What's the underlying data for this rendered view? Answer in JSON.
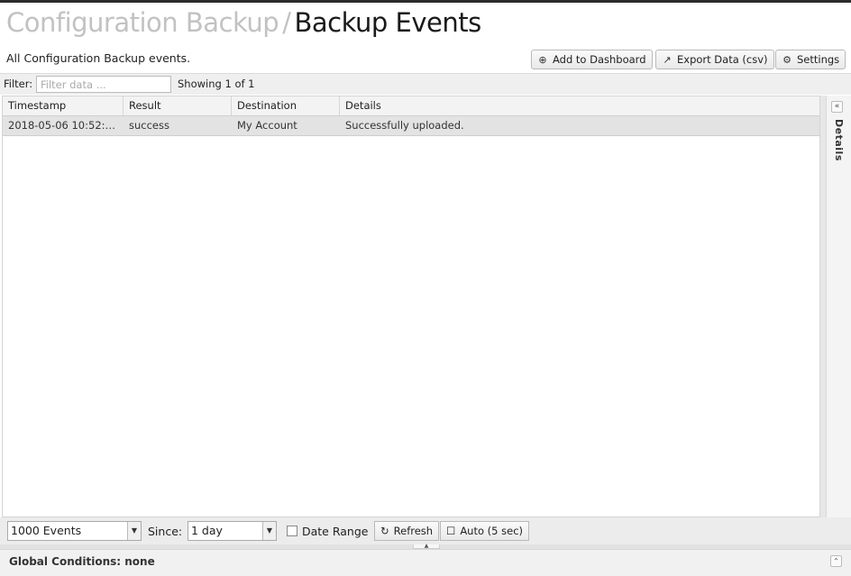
{
  "header": {
    "breadcrumb_parent": "Configuration Backup",
    "separator": "/",
    "title": "Backup Events",
    "subtitle": "All Configuration Backup events."
  },
  "toolbar": {
    "add_dashboard": "Add to Dashboard",
    "export": "Export Data (csv)",
    "settings": "Settings"
  },
  "filter": {
    "label": "Filter:",
    "placeholder": "Filter data ...",
    "showing": "Showing 1 of 1"
  },
  "table": {
    "columns": [
      "Timestamp",
      "Result",
      "Destination",
      "Details"
    ],
    "rows": [
      [
        "2018-05-06 10:52:0...",
        "success",
        "My Account",
        "Successfully uploaded."
      ]
    ]
  },
  "side_panel": {
    "label": "Details"
  },
  "bottom": {
    "events_select": "1000 Events",
    "since_label": "Since:",
    "since_select": "1 day",
    "date_range_label": "Date Range",
    "date_range_checked": false,
    "refresh": "Refresh",
    "auto": "Auto (5 sec)"
  },
  "footer": {
    "global_conditions": "Global Conditions: none"
  }
}
